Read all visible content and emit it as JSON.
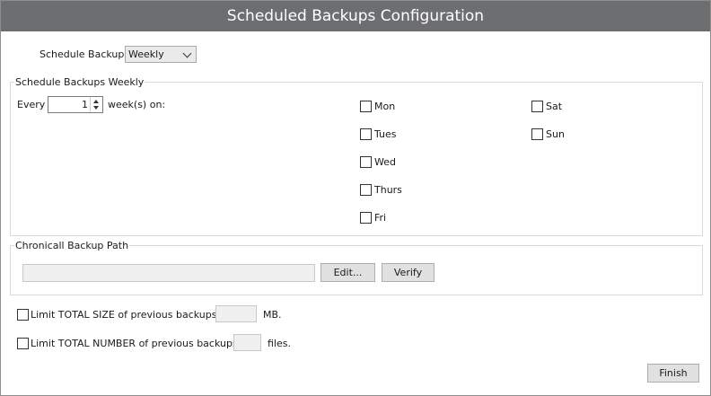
{
  "window": {
    "title": "Scheduled Backups Configuration"
  },
  "schedule": {
    "label": "Schedule Backups:",
    "selected": "Weekly"
  },
  "weekly": {
    "legend": "Schedule Backups Weekly",
    "every_label": "Every",
    "interval_value": "1",
    "interval_suffix": "week(s) on:",
    "days": [
      "Mon",
      "Tues",
      "Wed",
      "Thurs",
      "Fri",
      "Sat",
      "Sun"
    ]
  },
  "backup_path": {
    "legend": "Chronicall Backup Path",
    "value": "",
    "edit_label": "Edit...",
    "verify_label": "Verify"
  },
  "limits": {
    "size_label": "Limit TOTAL SIZE of previous backups to",
    "size_value": "",
    "size_unit": "MB.",
    "number_label": "Limit TOTAL NUMBER of previous backups to",
    "number_value": "",
    "number_unit": "files."
  },
  "footer": {
    "finish_label": "Finish"
  }
}
